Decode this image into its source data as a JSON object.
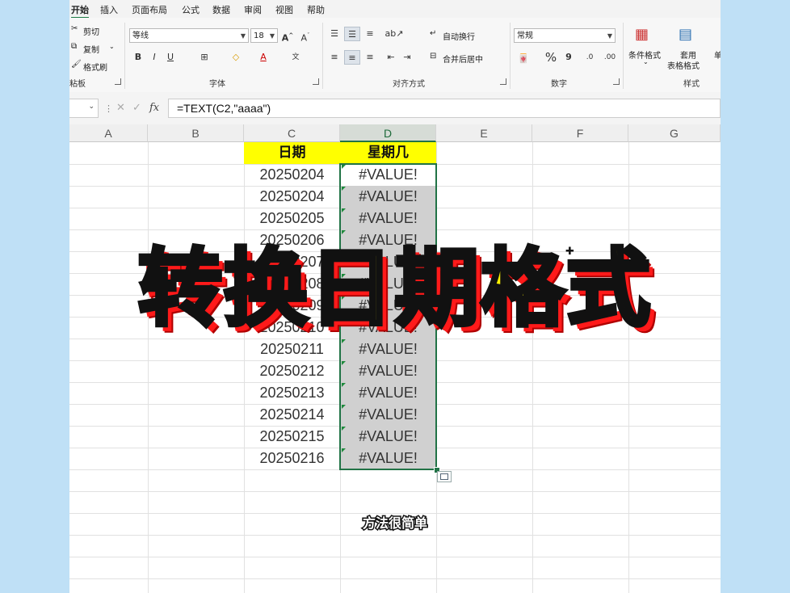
{
  "ribbon": {
    "tabs": [
      "开始",
      "插入",
      "页面布局",
      "公式",
      "数据",
      "审阅",
      "视图",
      "帮助"
    ],
    "clipboard": {
      "cut": "剪切",
      "copy": "复制",
      "format_painter": "格式刷",
      "group": "粘板"
    },
    "font": {
      "name": "等线",
      "size": "18",
      "group": "字体",
      "bold": "B",
      "italic": "I",
      "underline": "U",
      "grow": "A",
      "shrink": "A",
      "font_color": "A",
      "phonetic": "文"
    },
    "alignment": {
      "wrap": "自动换行",
      "merge": "合并后居中",
      "group": "对齐方式"
    },
    "number": {
      "format": "常规",
      "percent": "%",
      "comma": "9",
      "inc": ".0",
      "dec": ".00",
      "group": "数字"
    },
    "styles": {
      "conditional": "条件格式",
      "table_line1": "套用",
      "table_line2": "表格格式",
      "group": "样式",
      "extra": "单"
    }
  },
  "formula_bar": {
    "name_box": "",
    "fx": "fx",
    "formula": "=TEXT(C2,\"aaaa\")"
  },
  "columns": [
    "A",
    "B",
    "C",
    "D",
    "E",
    "F",
    "G"
  ],
  "selected_column": "D",
  "table": {
    "headers": [
      "日期",
      "星期几"
    ],
    "rows": [
      [
        "20250204",
        "#VALUE!"
      ],
      [
        "20250204",
        "#VALUE!"
      ],
      [
        "20250205",
        "#VALUE!"
      ],
      [
        "20250206",
        "#VALUE!"
      ],
      [
        "20250207",
        "#VALUE!"
      ],
      [
        "20250208",
        "#VALUE!"
      ],
      [
        "20250209",
        "#VALUE!"
      ],
      [
        "20250210",
        "#VALUE!"
      ],
      [
        "20250211",
        "#VALUE!"
      ],
      [
        "20250212",
        "#VALUE!"
      ],
      [
        "20250213",
        "#VALUE!"
      ],
      [
        "20250214",
        "#VALUE!"
      ],
      [
        "20250215",
        "#VALUE!"
      ],
      [
        "20250216",
        "#VALUE!"
      ]
    ]
  },
  "overlay": {
    "title": "转换日期格式",
    "subtitle": "方法很简单"
  },
  "colors": {
    "header_fill": "#ffff00",
    "selection": "#217346",
    "title_fill": "#fff200",
    "title_shadow": "#ff1a1a"
  }
}
